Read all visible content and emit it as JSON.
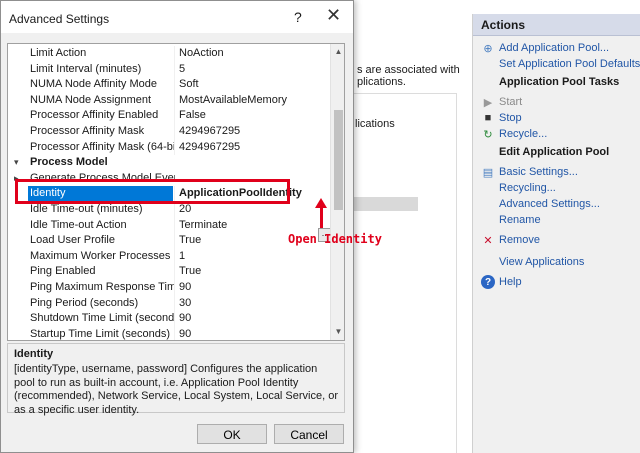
{
  "background": {
    "middle_lines": [
      "s are associated with",
      "plications."
    ],
    "column_text": "lications",
    "actions": {
      "header": "Actions",
      "items": [
        {
          "label": "Add Application Pool...",
          "icon": "add-pool-icon",
          "style": "link"
        },
        {
          "label": "Set Application Pool Defaults...",
          "icon": "",
          "style": "link"
        },
        {
          "label": "Application Pool Tasks",
          "icon": "",
          "style": "heading"
        },
        {
          "label": "Start",
          "icon": "play-icon",
          "style": "disabled"
        },
        {
          "label": "Stop",
          "icon": "stop-icon",
          "style": "link"
        },
        {
          "label": "Recycle...",
          "icon": "recycle-icon",
          "style": "link"
        },
        {
          "label": "Edit Application Pool",
          "icon": "",
          "style": "heading"
        },
        {
          "label": "Basic Settings...",
          "icon": "settings-icon",
          "style": "link"
        },
        {
          "label": "Recycling...",
          "icon": "",
          "style": "link"
        },
        {
          "label": "Advanced Settings...",
          "icon": "",
          "style": "link"
        },
        {
          "label": "Rename",
          "icon": "",
          "style": "link"
        },
        {
          "label": "Remove",
          "icon": "remove-icon",
          "style": "link"
        },
        {
          "label": "View Applications",
          "icon": "",
          "style": "link"
        },
        {
          "label": "Help",
          "icon": "help-icon",
          "style": "link"
        }
      ]
    }
  },
  "dialog": {
    "title": "Advanced Settings",
    "help_glyph": "?",
    "close_glyph": "✕",
    "grid": {
      "rows": [
        {
          "name": "Limit Action",
          "value": "NoAction"
        },
        {
          "name": "Limit Interval (minutes)",
          "value": "5"
        },
        {
          "name": "NUMA Node Affinity Mode",
          "value": "Soft"
        },
        {
          "name": "NUMA Node Assignment",
          "value": "MostAvailableMemory"
        },
        {
          "name": "Processor Affinity Enabled",
          "value": "False"
        },
        {
          "name": "Processor Affinity Mask",
          "value": "4294967295"
        },
        {
          "name": "Processor Affinity Mask (64-bit o",
          "value": "4294967295"
        },
        {
          "name": "Process Model",
          "value": "",
          "category": true,
          "toggle": "▾"
        },
        {
          "name": "Generate Process Model Event L",
          "value": "",
          "toggle": "▸"
        },
        {
          "name": "Identity",
          "value": "ApplicationPoolIdentity",
          "selected": true
        },
        {
          "name": "Idle Time-out (minutes)",
          "value": "20"
        },
        {
          "name": "Idle Time-out Action",
          "value": "Terminate"
        },
        {
          "name": "Load User Profile",
          "value": "True"
        },
        {
          "name": "Maximum Worker Processes",
          "value": "1"
        },
        {
          "name": "Ping Enabled",
          "value": "True"
        },
        {
          "name": "Ping Maximum Response Time (",
          "value": "90"
        },
        {
          "name": "Ping Period (seconds)",
          "value": "30"
        },
        {
          "name": "Shutdown Time Limit (seconds)",
          "value": "90"
        },
        {
          "name": "Startup Time Limit (seconds)",
          "value": "90"
        }
      ],
      "ellipsis_label": "..."
    },
    "annotation_label": "Open Identity",
    "description": {
      "title": "Identity",
      "text": "[identityType, username, password] Configures the application pool to run as built-in account, i.e. Application Pool Identity (recommended), Network Service, Local System, Local Service, or as a specific user identity."
    },
    "ok_label": "OK",
    "cancel_label": "Cancel"
  },
  "colors": {
    "accent": "#0078d7",
    "annotation": "#e0001b",
    "link": "#2156a6"
  }
}
